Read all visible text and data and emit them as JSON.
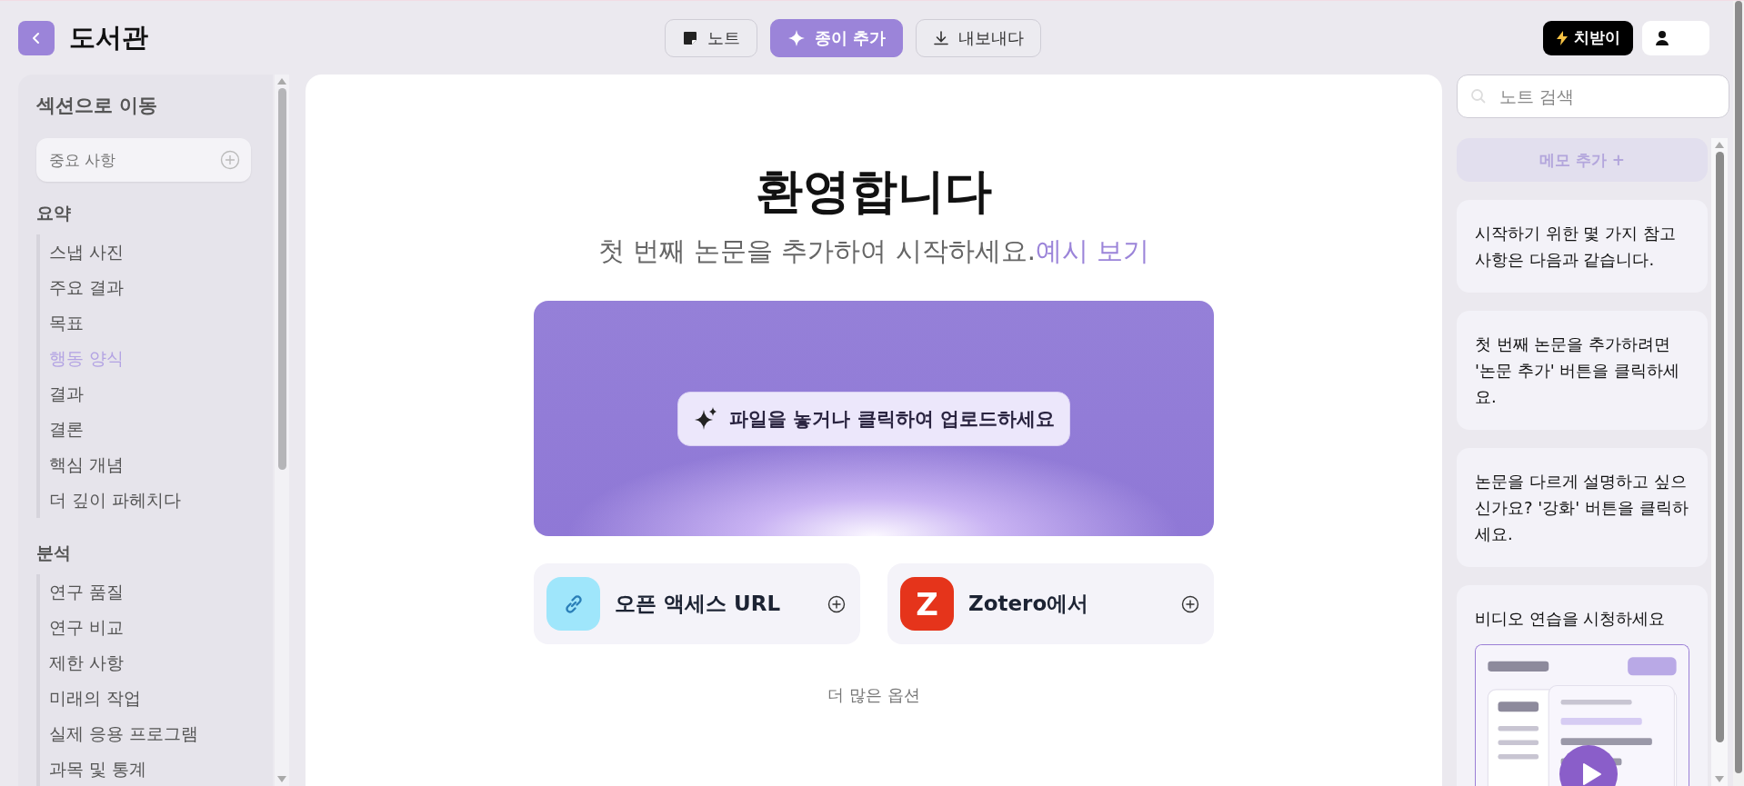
{
  "header": {
    "title": "도서관"
  },
  "toolbar": [
    {
      "kind": "note",
      "label": "노트",
      "primary": false
    },
    {
      "kind": "add",
      "label": "종이 추가",
      "primary": true
    },
    {
      "kind": "export",
      "label": "내보내다",
      "primary": false
    }
  ],
  "upgrade_button": {
    "label": "치받이"
  },
  "sidebar": {
    "title": "섹션으로 이동",
    "field": {
      "placeholder": "중요 사항"
    },
    "sections": [
      {
        "heading": "요약",
        "items": [
          {
            "label": "스냅 사진",
            "selected": false
          },
          {
            "label": "주요 결과",
            "selected": false
          },
          {
            "label": "목표",
            "selected": false
          },
          {
            "label": "행동 양식",
            "selected": true
          },
          {
            "label": "결과",
            "selected": false
          },
          {
            "label": "결론",
            "selected": false
          },
          {
            "label": "핵심 개념",
            "selected": false
          },
          {
            "label": "더 깊이 파헤치다",
            "selected": false
          }
        ]
      },
      {
        "heading": "분석",
        "items": [
          {
            "label": "연구 품질",
            "selected": false
          },
          {
            "label": "연구 비교",
            "selected": false
          },
          {
            "label": "제한 사항",
            "selected": false
          },
          {
            "label": "미래의 작업",
            "selected": false
          },
          {
            "label": "실제 응용 프로그램",
            "selected": false
          },
          {
            "label": "과목 및 통계",
            "selected": false
          }
        ]
      }
    ]
  },
  "main": {
    "title": "환영합니다",
    "subtitle": "첫 번째 논문을 추가하여 시작하세요.",
    "subtitle_link": "예시 보기",
    "dropzone": {
      "label": "파일을 놓거나 클릭하여 업로드하세요"
    },
    "sources": [
      {
        "kind": "link",
        "label": "오픈 액세스 URL"
      },
      {
        "kind": "zotero",
        "label": "Zotero에서",
        "icon_text": "Z"
      }
    ],
    "more": "더 많은 옵션"
  },
  "notes_panel": {
    "search": {
      "placeholder": "노트 검색"
    },
    "add_button": "메모 추가 +",
    "notes": [
      {
        "kind": "text",
        "text": "시작하기 위한 몇 가지 참고 사항은 다음과 같습니다."
      },
      {
        "kind": "text",
        "text": "첫 번째 논문을 추가하려면 '논문 추가' 버튼을 클릭하세요."
      },
      {
        "kind": "text",
        "text": "논문을 다르게 설명하고 싶으신가요? '강화' 버튼을 클릭하세요."
      },
      {
        "kind": "video",
        "text": "비디오 연습을 시청하세요"
      }
    ]
  }
}
